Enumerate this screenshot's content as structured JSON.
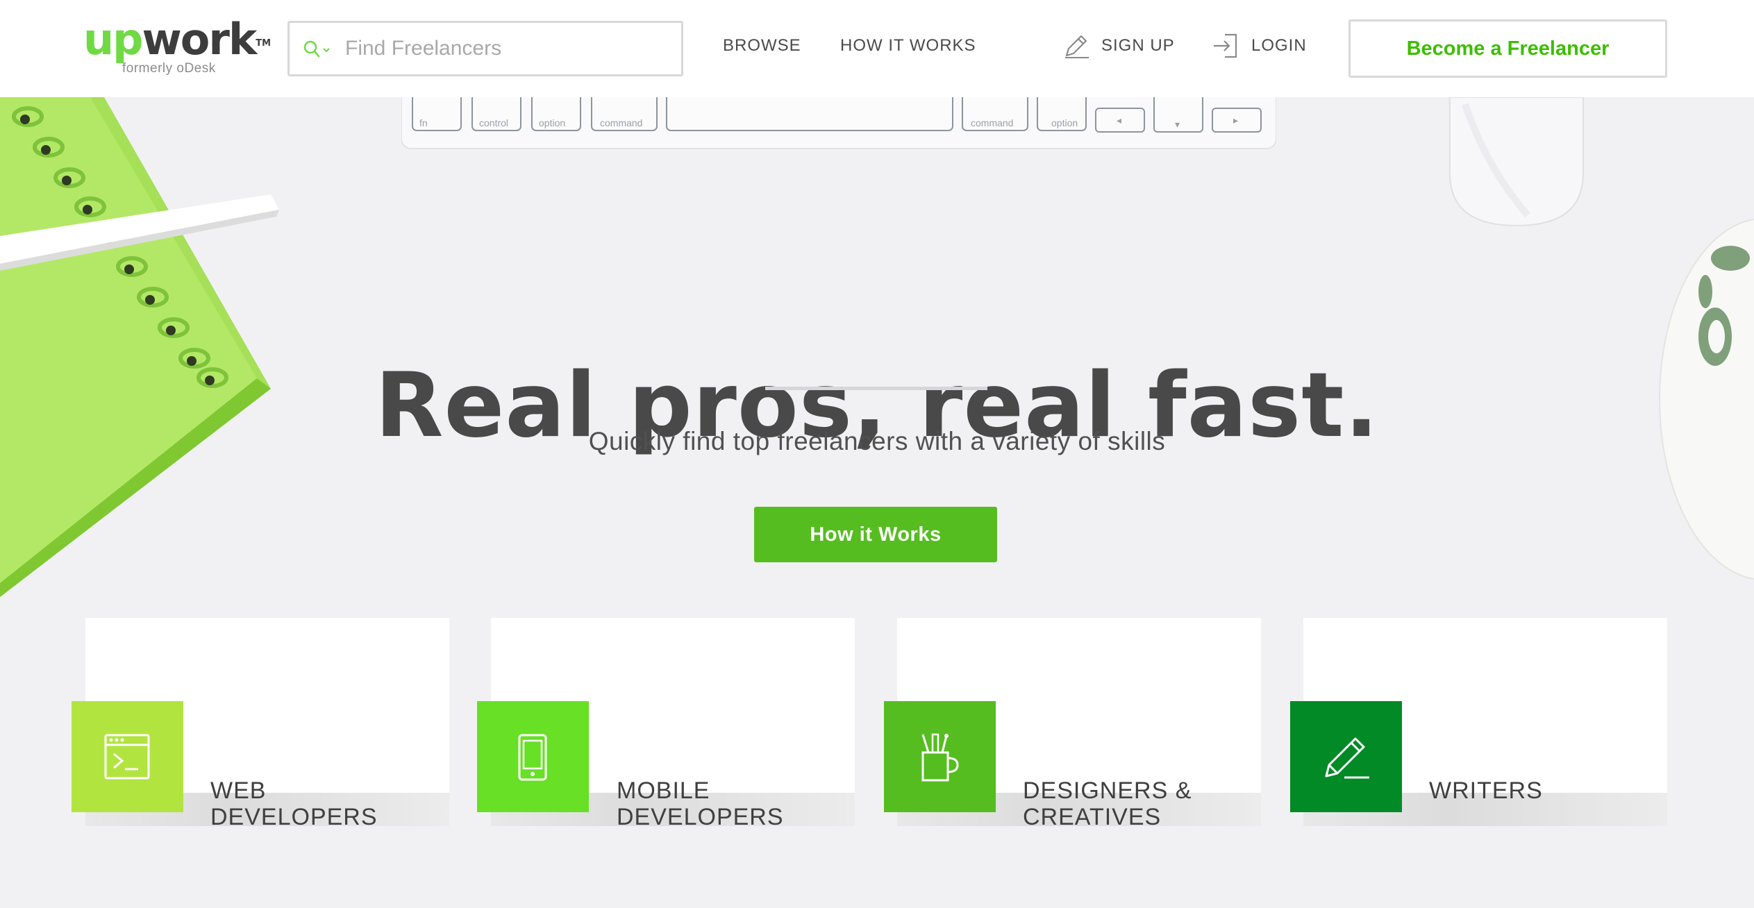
{
  "header": {
    "logo_up": "up",
    "logo_work": "work",
    "logo_tm": "TM",
    "logo_sub": "formerly oDesk",
    "search_placeholder": "Find Freelancers",
    "nav": {
      "browse": "BROWSE",
      "how_it_works": "HOW IT WORKS",
      "sign_up": "SIGN UP",
      "login": "LOGIN"
    },
    "become_freelancer": "Become a Freelancer"
  },
  "hero": {
    "headline": "Real pros, real fast.",
    "subhead": "Quickly find top freelancers with a variety of skills",
    "cta": "How it Works",
    "keyboard_keys": [
      "fn",
      "control",
      "option",
      "command",
      "command",
      "option"
    ]
  },
  "categories": [
    {
      "label": "WEB\nDEVELOPERS",
      "icon": "terminal-window-icon",
      "color": "#b2e43f"
    },
    {
      "label": "MOBILE\nDEVELOPERS",
      "icon": "mobile-phone-icon",
      "color": "#67e026"
    },
    {
      "label": "DESIGNERS &\nCREATIVES",
      "icon": "pencil-cup-icon",
      "color": "#55bd20"
    },
    {
      "label": "WRITERS",
      "icon": "pencil-icon",
      "color": "#028a26"
    }
  ],
  "colors": {
    "brand_green": "#6fda44",
    "cta_green": "#55bd20",
    "text_dark": "#494949"
  }
}
